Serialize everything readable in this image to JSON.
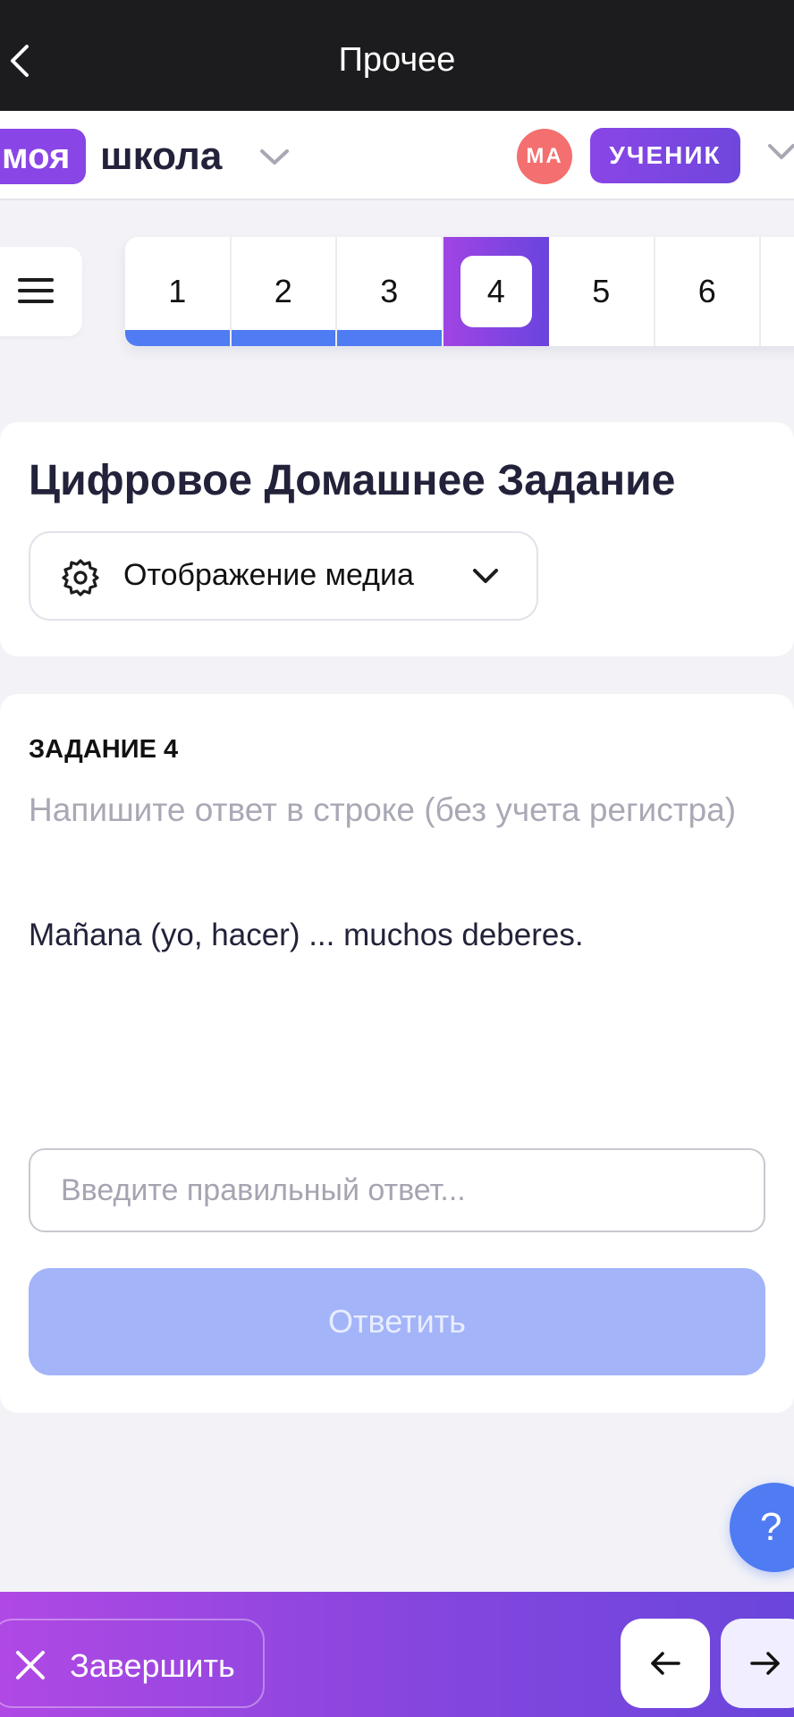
{
  "topbar": {
    "title": "Прочее"
  },
  "header": {
    "logo_part1": "моя",
    "logo_part2": "школа",
    "avatar_initials": "МА",
    "role": "УЧЕНИК"
  },
  "question_nav": {
    "items": [
      {
        "label": "1",
        "state": "done"
      },
      {
        "label": "2",
        "state": "done"
      },
      {
        "label": "3",
        "state": "done"
      },
      {
        "label": "4",
        "state": "active"
      },
      {
        "label": "5",
        "state": "pending"
      },
      {
        "label": "6",
        "state": "pending"
      }
    ]
  },
  "page": {
    "title": "Цифровое Домашнее Задание",
    "media_button": "Отображение медиа"
  },
  "task": {
    "number_label": "ЗАДАНИЕ 4",
    "instruction": "Напишите ответ в строке (без учета регистра)",
    "text": "Mañana (yo, hacer) ... muchos deberes.",
    "input_placeholder": "Введите правильный ответ...",
    "input_value": "",
    "submit_label": "Ответить"
  },
  "help": {
    "label": "?"
  },
  "bottombar": {
    "finish_label": "Завершить"
  },
  "colors": {
    "accent_purple": "#8a45e6",
    "accent_blue": "#4f7bf3",
    "avatar_red": "#f46f6f",
    "submit_disabled": "#a4b4f8"
  },
  "icons": [
    "back-chevron-icon",
    "chevron-down-icon",
    "hamburger-menu-icon",
    "gear-icon",
    "close-icon",
    "arrow-left-icon",
    "arrow-right-icon"
  ]
}
